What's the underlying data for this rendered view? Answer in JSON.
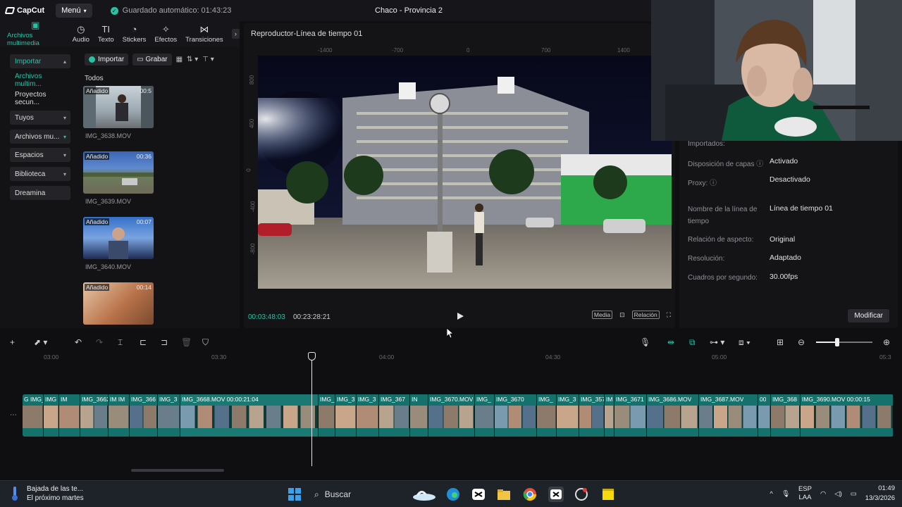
{
  "app": {
    "brand": "CapCut",
    "menu_label": "Menú",
    "autosave": "Guardado automático: 01:43:23",
    "project_title": "Chaco - Provincia 2"
  },
  "tooltabs": [
    {
      "label": "Archivos multimedia",
      "icon": "media-icon",
      "glyph": "▣"
    },
    {
      "label": "Audio",
      "icon": "audio-icon",
      "glyph": "◷"
    },
    {
      "label": "Texto",
      "icon": "text-icon",
      "glyph": "TI"
    },
    {
      "label": "Stickers",
      "icon": "sticker-icon",
      "glyph": "◔"
    },
    {
      "label": "Efectos",
      "icon": "effects-icon",
      "glyph": "✧"
    },
    {
      "label": "Transiciones",
      "icon": "transitions-icon",
      "glyph": "⋈"
    }
  ],
  "sidebar": {
    "items": [
      {
        "label": "Importar",
        "caret": "▴"
      },
      {
        "label": "Archivos multim...",
        "caret": ""
      },
      {
        "label": "Proyectos secun...",
        "caret": ""
      },
      {
        "label": "Tuyos",
        "caret": "▾"
      },
      {
        "label": "Archivos mu...",
        "caret": "▾"
      },
      {
        "label": "Espacios",
        "caret": "▾"
      },
      {
        "label": "Biblioteca",
        "caret": "▾"
      },
      {
        "label": "Dreamina",
        "caret": ""
      }
    ]
  },
  "media": {
    "import_label": "Importar",
    "record_label": "Grabar",
    "section_label": "Todos",
    "items": [
      {
        "badge": "Añadido",
        "duration": "00:5",
        "name": "IMG_3638.MOV"
      },
      {
        "badge": "Añadido",
        "duration": "00:36",
        "name": "IMG_3639.MOV"
      },
      {
        "badge": "Añadido",
        "duration": "00:07",
        "name": "IMG_3640.MOV"
      },
      {
        "badge": "Añadido",
        "duration": "00:14",
        "name": ""
      }
    ]
  },
  "player": {
    "title": "Reproductor-Línea de tiempo 01",
    "ruler_h": [
      "-1400",
      "-700",
      "0",
      "700",
      "1400"
    ],
    "ruler_v": [
      "800",
      "400",
      "0",
      "-400",
      "-800"
    ],
    "current_time": "00:03:48:03",
    "total_time": "00:23:28:21",
    "btn_media": "Media",
    "btn_ratio": "Relación"
  },
  "properties": {
    "rows": [
      {
        "label": "Importados:",
        "value": ""
      },
      {
        "label": "Disposición de capas",
        "value": "Activado"
      },
      {
        "label": "Proxy:",
        "value": "Desactivado"
      },
      {
        "label": "Nombre de la línea de",
        "label2": "tiempo",
        "value": "Línea de tiempo 01"
      },
      {
        "label": "Relación de aspecto:",
        "value": "Original"
      },
      {
        "label": "Resolución:",
        "value": "Adaptado"
      },
      {
        "label": "Cuadros por segundo:",
        "value": "30.00fps"
      }
    ],
    "modify_label": "Modificar"
  },
  "timeline": {
    "ruler": [
      "03:00",
      "03:30",
      "04:00",
      "04:30",
      "05:00",
      "05:3"
    ],
    "clips": [
      {
        "label": "G IMG_36",
        "color": "#15716b"
      },
      {
        "label": "IMG",
        "color": "#15716b"
      },
      {
        "label": "IM",
        "color": "#15716b"
      },
      {
        "label": "IMG_3662",
        "color": "#15716b"
      },
      {
        "label": "IM IM",
        "color": "#15716b"
      },
      {
        "label": "IMG_366",
        "color": "#15716b"
      },
      {
        "label": "IMG_3",
        "color": "#15716b"
      },
      {
        "label": "IMG_3668.MOV  00:00:21:04",
        "color": "#1a7a73"
      },
      {
        "label": "IMG_3",
        "color": "#15716b"
      },
      {
        "label": "IMG_3",
        "color": "#15716b"
      },
      {
        "label": "IMG_3",
        "color": "#15716b"
      },
      {
        "label": "IMG_367",
        "color": "#15716b"
      },
      {
        "label": "IN",
        "color": "#15716b"
      },
      {
        "label": "IMG_3670.MOV",
        "color": "#15716b"
      },
      {
        "label": "IMG_",
        "color": "#15716b"
      },
      {
        "label": "IMG_3670",
        "color": "#15716b"
      },
      {
        "label": "IMG_",
        "color": "#15716b"
      },
      {
        "label": "IMG_3",
        "color": "#15716b"
      },
      {
        "label": "IMG_357",
        "color": "#15716b"
      },
      {
        "label": "IM",
        "color": "#15716b"
      },
      {
        "label": "IMG_3671",
        "color": "#15716b"
      },
      {
        "label": "IMG_3686.MOV",
        "color": "#15716b"
      },
      {
        "label": "IMG_3687.MOV",
        "color": "#15716b"
      },
      {
        "label": "00",
        "color": "#15716b"
      },
      {
        "label": "IMG_368",
        "color": "#15716b"
      },
      {
        "label": "IMG_3690.MOV  00:00:15",
        "color": "#15716b"
      }
    ]
  },
  "taskbar": {
    "weather_line1": "Bajada de las te...",
    "weather_line2": "El próximo martes",
    "search_label": "Buscar",
    "lang_line1": "ESP",
    "lang_line2": "LAA",
    "time": "01:49",
    "date": "13/3/2026"
  }
}
